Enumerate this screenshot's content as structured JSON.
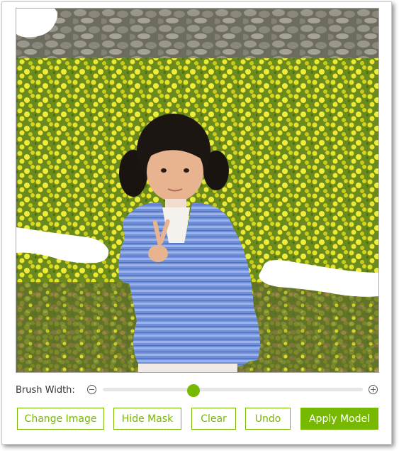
{
  "controls": {
    "brush_width_label": "Brush Width:",
    "brush_width_value": 0.35
  },
  "buttons": {
    "change_image": "Change Image",
    "hide_mask": "Hide Mask",
    "clear": "Clear",
    "undo": "Undo",
    "apply_model": "Apply Model"
  },
  "icons": {
    "decrease": "minus-circle-icon",
    "increase": "plus-circle-icon"
  },
  "colors": {
    "accent": "#76b900",
    "mask": "#ffffff"
  }
}
